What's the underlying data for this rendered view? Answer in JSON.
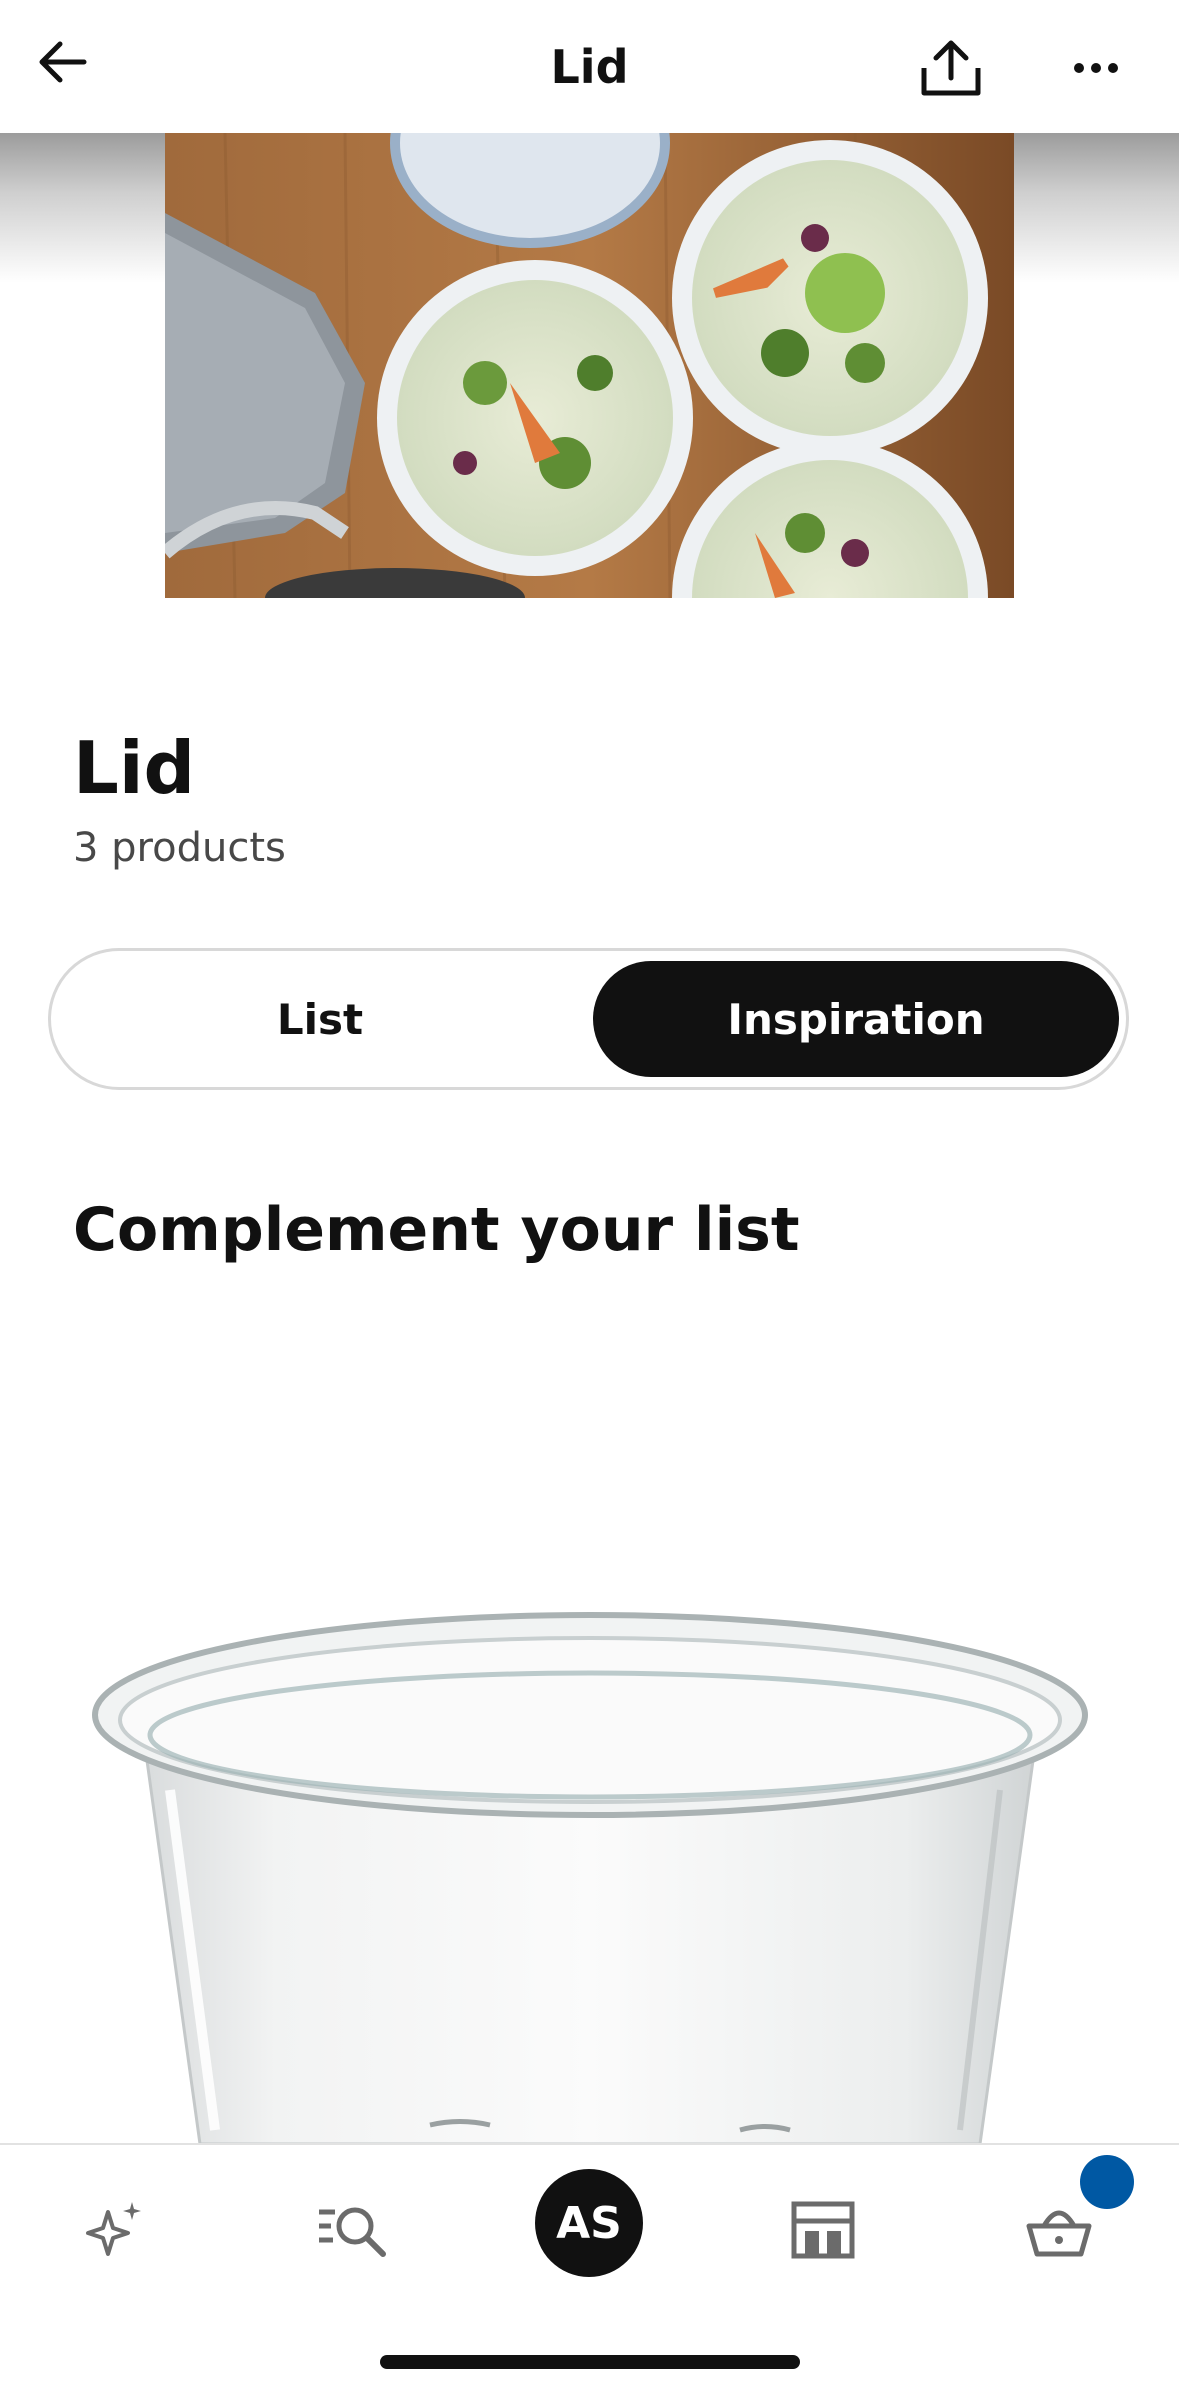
{
  "header": {
    "title": "Lid",
    "back_icon": "arrow-left-icon",
    "share_icon": "share-icon",
    "more_icon": "more-horizontal-icon"
  },
  "hero": {
    "image": "meal-prep-containers-with-soup-photo"
  },
  "list": {
    "title": "Lid",
    "count": "3 products"
  },
  "view_toggle": {
    "options": [
      {
        "label": "List",
        "selected": false
      },
      {
        "label": "Inspiration",
        "selected": true
      }
    ]
  },
  "complement": {
    "heading": "Complement your list",
    "product_image": "glass-food-container-photo"
  },
  "tabbar": {
    "items": [
      {
        "name": "inspiration",
        "icon": "sparkle-icon"
      },
      {
        "name": "search",
        "icon": "search-icon"
      },
      {
        "name": "profile",
        "avatar_text": "AS"
      },
      {
        "name": "stores",
        "icon": "store-icon"
      },
      {
        "name": "cart",
        "icon": "basket-icon"
      }
    ]
  },
  "colors": {
    "accent": "#111111",
    "badge": "#0058a3",
    "border": "#d8d8d8",
    "muted_text": "#484848"
  }
}
